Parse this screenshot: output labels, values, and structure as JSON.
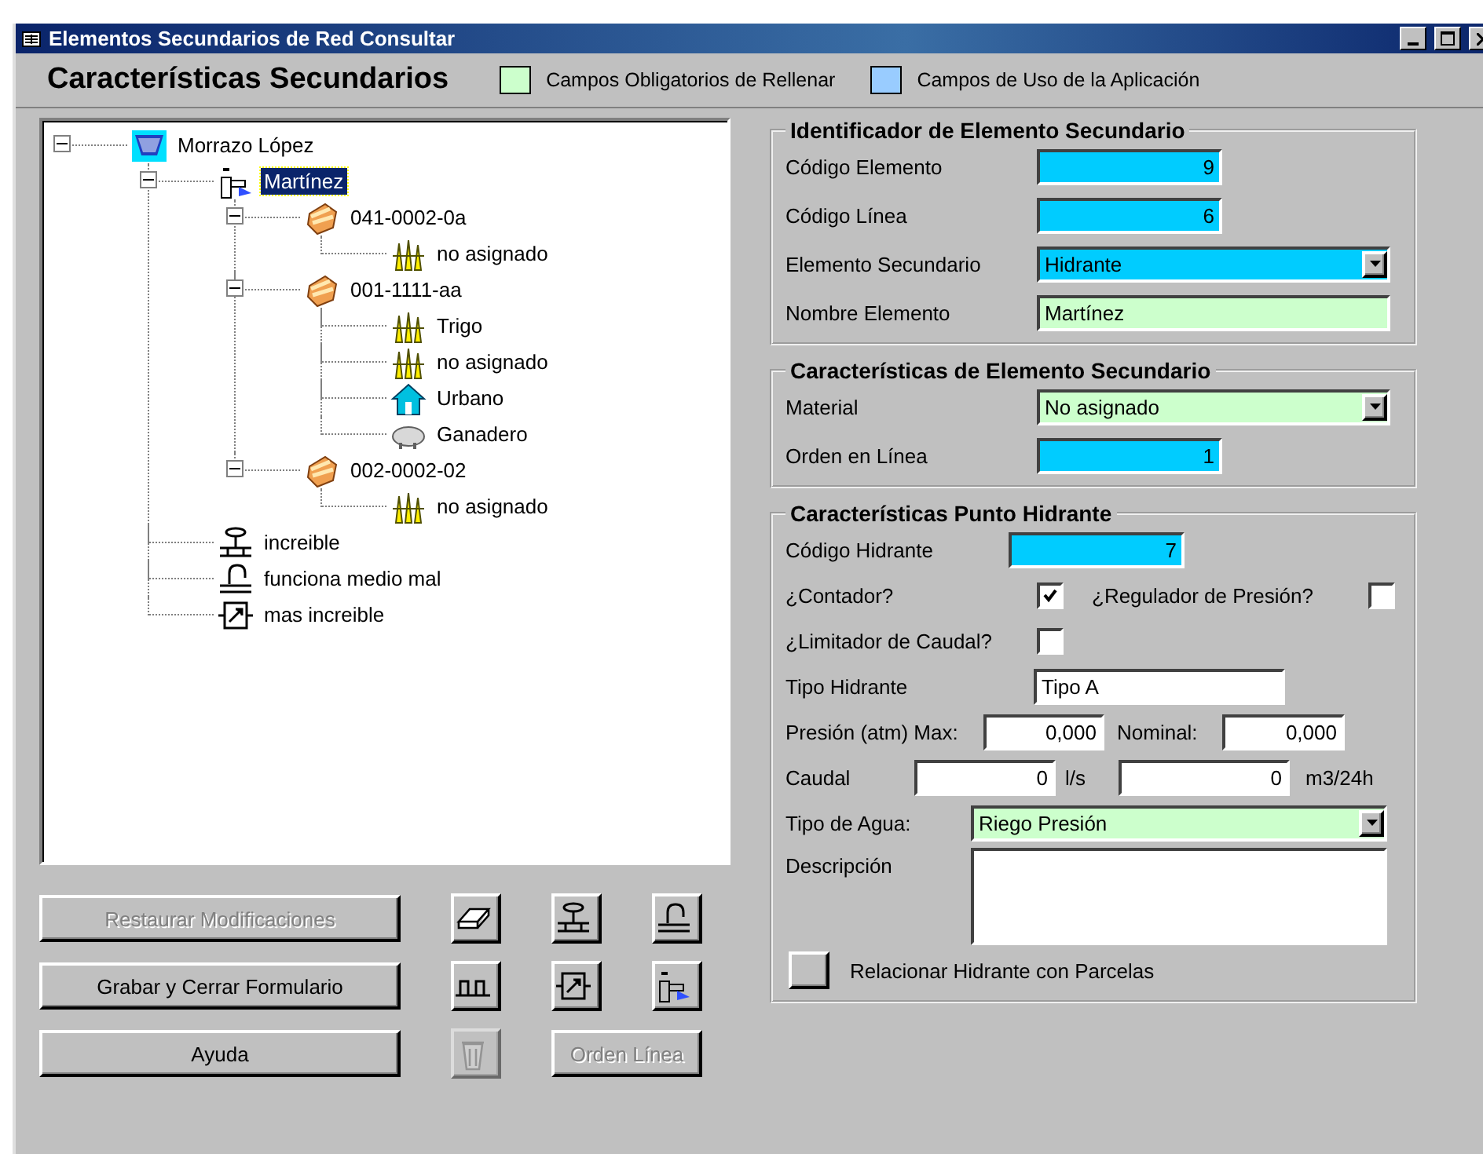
{
  "window": {
    "title": "Elementos Secundarios de Red Consultar"
  },
  "header": {
    "title": "Características Secundarios",
    "legend": [
      {
        "label": "Campos Obligatorios de Rellenar",
        "color": "#ccffcc"
      },
      {
        "label": "Campos de Uso de la Aplicación",
        "color": "#99ccff"
      }
    ]
  },
  "tree": {
    "nodes": [
      {
        "label": "Morrazo López",
        "kind": "reservoir",
        "selected": false,
        "expanded": true,
        "children": [
          {
            "label": "Martínez",
            "kind": "hydrant",
            "selected": true,
            "expanded": true,
            "children": [
              {
                "label": "041-0002-0a",
                "kind": "parcel",
                "selected": false,
                "expanded": true,
                "children": [
                  {
                    "label": "no asignado",
                    "kind": "crop",
                    "selected": false
                  }
                ]
              },
              {
                "label": "001-1111-aa",
                "kind": "parcel",
                "selected": false,
                "expanded": true,
                "children": [
                  {
                    "label": "Trigo",
                    "kind": "crop",
                    "selected": false
                  },
                  {
                    "label": "no asignado",
                    "kind": "crop",
                    "selected": false
                  },
                  {
                    "label": "Urbano",
                    "kind": "house",
                    "selected": false
                  },
                  {
                    "label": "Ganadero",
                    "kind": "pig",
                    "selected": false
                  }
                ]
              },
              {
                "label": "002-0002-02",
                "kind": "parcel",
                "selected": false,
                "expanded": true,
                "children": [
                  {
                    "label": "no asignado",
                    "kind": "crop",
                    "selected": false
                  }
                ]
              }
            ]
          },
          {
            "label": "increible",
            "kind": "valve",
            "selected": false
          },
          {
            "label": "funciona medio mal",
            "kind": "faucet",
            "selected": false
          },
          {
            "label": "mas increible",
            "kind": "box",
            "selected": false
          }
        ]
      }
    ]
  },
  "buttons": [
    {
      "kind": "text",
      "label": "Restaurar Modificaciones",
      "disabled": true
    },
    {
      "kind": "slab",
      "disabled": false
    },
    {
      "kind": "valve",
      "disabled": false
    },
    {
      "kind": "faucet",
      "disabled": false
    },
    {
      "kind": "text",
      "label": "Grabar y Cerrar Formulario",
      "disabled": false
    },
    {
      "kind": "meter",
      "disabled": false
    },
    {
      "kind": "box",
      "disabled": false
    },
    {
      "kind": "hydrant",
      "disabled": false
    },
    {
      "kind": "text",
      "label": "Ayuda",
      "disabled": false
    },
    {
      "kind": "trash",
      "disabled": true
    },
    {
      "kind": "wide",
      "label": "Orden Línea",
      "disabled": true
    }
  ],
  "identifier": {
    "title": "Identificador de Elemento Secundario",
    "fields": [
      {
        "label": "Código Elemento",
        "kind": "number",
        "value": "9",
        "color": "#00ccff"
      },
      {
        "label": "Código Línea",
        "kind": "number",
        "value": "6",
        "color": "#00ccff"
      },
      {
        "label": "Elemento Secundario",
        "kind": "combo",
        "value": "Hidrante",
        "color": "#00ccff"
      },
      {
        "label": "Nombre Elemento",
        "kind": "text",
        "value": "Martínez",
        "color": "#ccffcc"
      }
    ]
  },
  "characteristics": {
    "title": "Características de Elemento Secundario",
    "fields": [
      {
        "label": "Material",
        "kind": "combo",
        "value": "No asignado",
        "color": "#ccffcc"
      },
      {
        "label": "Orden en Línea",
        "kind": "number",
        "value": "1",
        "color": "#00ccff"
      }
    ]
  },
  "hydrant": {
    "title": "Características Punto Hidrante",
    "code": {
      "label": "Código Hidrante",
      "value": "7",
      "color": "#00ccff"
    },
    "meter": {
      "label": "¿Contador?",
      "checked": true
    },
    "regulator": {
      "label": "¿Regulador de Presión?",
      "checked": false
    },
    "limiter": {
      "label": "¿Limitador de Caudal?",
      "checked": false
    },
    "type": {
      "label": "Tipo Hidrante",
      "value": "Tipo A"
    },
    "pressure": {
      "label": "Presión (atm) Max:",
      "max": "0,000",
      "nominal_label": "Nominal:",
      "nominal": "0,000"
    },
    "flow": {
      "label": "Caudal",
      "value": "0",
      "unit": "l/s",
      "daily": "0",
      "daily_unit": "m3/24h"
    },
    "water": {
      "label": "Tipo de Agua:",
      "value": "Riego Presión",
      "color": "#ccffcc"
    },
    "description": {
      "label": "Descripción"
    },
    "relate": {
      "label": "Relacionar Hidrante con Parcelas"
    }
  }
}
